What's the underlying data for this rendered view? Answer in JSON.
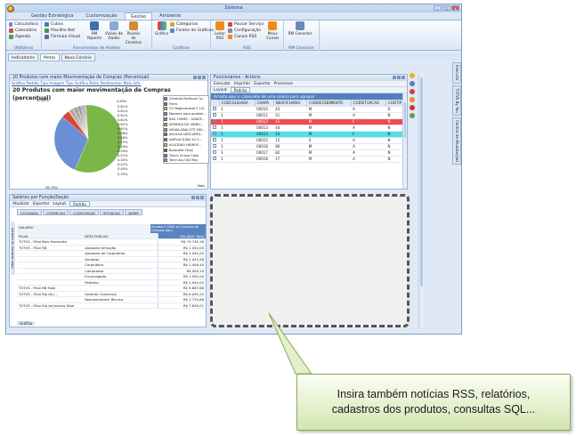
{
  "window": {
    "title": "Sistema"
  },
  "tabs": [
    "Gestão Estratégica",
    "Customização",
    "Gestão",
    "Ambiente"
  ],
  "active_tab": "Gestão",
  "ribbon": {
    "group1": {
      "items": [
        "Calculadora",
        "Calendário",
        "Agenda"
      ],
      "label": "Utilitários"
    },
    "group2": {
      "items": [
        "Cubos",
        "Planilha Net",
        "Fórmula Visual"
      ],
      "label": "Ferramentas de Análise"
    },
    "group2_big": [
      "RM Reports",
      "Visões de Dados",
      "Painéis de Cenários"
    ],
    "group3": {
      "big": "Gráfico",
      "items": [
        "Categorias",
        "Fontes de Gráficos"
      ],
      "label": "Gráficos"
    },
    "group4": {
      "big": "Leitor RSS",
      "items": [
        "Pausar Serviço",
        "Configuração",
        "Canais RSS"
      ],
      "big2": "Meus Canais",
      "label": "RSS"
    },
    "group5": {
      "big": "RM Conector",
      "label": "RM Conector"
    }
  },
  "workbar": [
    "Indicadores",
    "Metas",
    "Novo Cenário"
  ],
  "pie_panel": {
    "title": "20 Produtos com maior Movimentação de Compras (Percentual)",
    "links": "Gráfico Padrão  Tipo Imagem  Tipo Gráfico  Rotar  Redimentar  Mais Info.",
    "chart_title": "20 Produtos com maior movimentação de Compras (percentual)",
    "legend": [
      "Cimento Portland Co...",
      "Ferro",
      "CO Regenerável 5 1/4",
      "Madeira para andaim...",
      "BAS 150MG - SANOF...",
      "SERINGA DE VIDRO...",
      "NOVALGINA GTS 500...",
      "AGULHA DESCARTA...",
      "AMPLACILINA 1G E...",
      "ALGODAO HIDROF...",
      "Barquete Flexy",
      "Trinco Ciroza Claro",
      "Torre Azul Del Rey"
    ],
    "label_more": "Mais"
  },
  "chart_data": {
    "type": "pie",
    "title": "20 Produtos com maior movimentação de Compras (percentual)",
    "labels_visible": [
      "30.63%",
      "3.89%",
      "0.81%",
      "0.81%",
      "0.61%",
      "0.61%",
      "0.61%",
      "0.61%",
      "0.58%",
      "0.58%",
      "0.57%",
      "0.54%",
      "0.54%",
      "0.51%",
      "0.50%",
      "0.42%",
      "0.40%",
      "0.39%",
      "58.74%"
    ],
    "values": [
      58.74,
      30.63,
      3.89,
      0.81,
      0.81,
      0.61,
      0.61,
      0.61,
      0.61,
      0.58,
      0.58,
      0.57,
      0.54,
      0.54,
      0.51,
      0.5,
      0.42,
      0.4,
      0.39
    ],
    "colors": [
      "#7ab648",
      "#6a8fd4",
      "#d24a3c",
      "#e8c64a",
      "#c067c8",
      "#3fb3c6",
      "#f19a38",
      "#9a9a9a",
      "#7b5ea7",
      "#4f9a5f",
      "#d4d46a",
      "#a03c3c",
      "#4a7ac8",
      "#e07aa0",
      "#60c070",
      "#c09050",
      "#5050a0",
      "#a0a0d0",
      "#d08030"
    ]
  },
  "actions_panel": {
    "title": "Funcionários - Actions",
    "toolbar": [
      "Executar",
      "Imprimir",
      "Exportar",
      "Processos"
    ],
    "layout_label": "Layout",
    "layout_value": "Padrão",
    "hint": "Arraste aqui o cabeçalho de uma coluna para agrupar",
    "columns": [
      "CODCOLIGADA",
      "CHAPA",
      "NEOFICHARIO",
      "CODRECEBIMENTO",
      "CODSITUACAO",
      "CODTIP"
    ],
    "rows": [
      [
        "1",
        "00010",
        "43",
        "M",
        "A",
        "D"
      ],
      [
        "1",
        "00011",
        "41",
        "M",
        "A",
        "N"
      ],
      [
        "1",
        "00012",
        "43",
        "M",
        "F",
        "N"
      ],
      [
        "1",
        "00013",
        "44",
        "M",
        "A",
        "N"
      ],
      [
        "1",
        "00014",
        "14",
        "M",
        "F",
        "N"
      ],
      [
        "1",
        "00015",
        "15",
        "S",
        "A",
        "N"
      ],
      [
        "1",
        "00016",
        "80",
        "M",
        "A",
        "N"
      ],
      [
        "1",
        "00017",
        "82",
        "M",
        "A",
        "N"
      ],
      [
        "1",
        "00018",
        "17",
        "M",
        "A",
        "N"
      ]
    ],
    "row_styles": [
      "",
      "",
      "red",
      "",
      "cyan",
      "",
      "",
      "",
      ""
    ]
  },
  "salary_panel": {
    "title": "Salários por Função/Seção",
    "toolbar": [
      "Atualizar",
      "Exportar",
      "Layout"
    ],
    "layout_value": "Padrão",
    "tabs": [
      "COLIGADA",
      "CODSECAO",
      "CODFUNCAO",
      "SITUACAO",
      "NOME"
    ],
    "measure": "Arrasta e Solte as Colunas do Campos Aqui",
    "salario_label": "SALARIO",
    "row_fields": [
      "FILIAL",
      "DESCFUNCAO"
    ],
    "col_header": "SALARIO Total",
    "rows": [
      {
        "a": "TOTVS - Filial Belo Horizonte",
        "b": "",
        "v": "R$ 79.745,18"
      },
      {
        "a": "TOTVS - Filial RB",
        "b": "Ajudante Armação",
        "v": "R$ 1.092,00"
      },
      {
        "a": "",
        "b": "Ajudante de Carpinteiro",
        "v": "R$ 1.092,00"
      },
      {
        "a": "",
        "b": "Armador",
        "v": "R$ 2.043,38"
      },
      {
        "a": "",
        "b": "Carpinteiro",
        "v": "R$ 2.406,40"
      },
      {
        "a": "",
        "b": "Comprador",
        "v": "R$ 959,10"
      },
      {
        "a": "",
        "b": "Encarregado",
        "v": "R$ 1.092,00"
      },
      {
        "a": "",
        "b": "Pedreiro",
        "v": "R$ 1.092,00"
      },
      {
        "a": "TOTVS - Filial RB Total",
        "b": "",
        "v": "R$ 9.867,88"
      },
      {
        "a": "TOTVS - Filial Rio de J...",
        "b": "Gerente Comercial",
        "v": "R$ 6.095,25"
      },
      {
        "a": "",
        "b": "Representante Técnico",
        "v": "R$ 1.734,66"
      },
      {
        "a": "TOTVS - Filial Rio de Janeiro Total",
        "b": "",
        "v": "R$ 7.830,01"
      }
    ],
    "footer": "Gráfico",
    "vtab": "Arraste os Campos Aqui"
  },
  "right_strip": [
    "Executar",
    "TOTVS By You",
    "Central de Atualizações"
  ],
  "callout": {
    "line1": "Insira também notícias RSS, relatórios,",
    "line2": "cadastros dos produtos, consultas SQL..."
  }
}
